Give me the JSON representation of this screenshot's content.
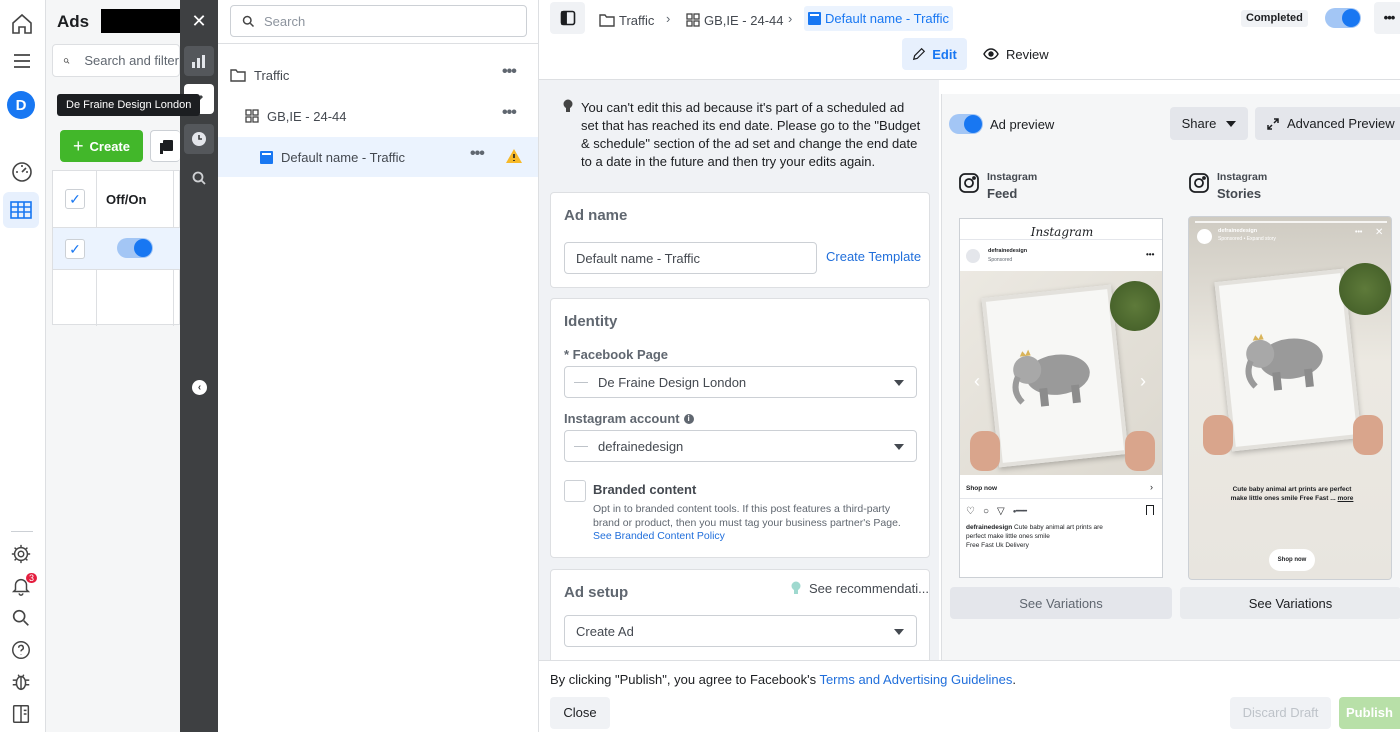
{
  "app": {
    "title": "Ads",
    "avatar_letter": "D",
    "tooltip": "De Fraine Design London",
    "notification_count": "3"
  },
  "ads_manager": {
    "search_placeholder": "Search and filter",
    "create_label": "Create",
    "col_offon": "Off/On"
  },
  "tree": {
    "search_placeholder": "Search",
    "items": [
      {
        "label": "Traffic"
      },
      {
        "label": "GB,IE - 24-44"
      },
      {
        "label": "Default name - Traffic"
      }
    ]
  },
  "breadcrumb": {
    "campaign": "Traffic",
    "adset": "GB,IE - 24-44",
    "ad": "Default name - Traffic"
  },
  "topbar": {
    "status": "Completed",
    "edit_label": "Edit",
    "review_label": "Review"
  },
  "notice": {
    "text": "You can't edit this ad because it's part of a scheduled ad set that has reached its end date. Please go to the \"Budget & schedule\" section of the ad set and change the end date to a date in the future and then try your edits again."
  },
  "ad_name": {
    "heading": "Ad name",
    "value": "Default name - Traffic",
    "create_template": "Create Template"
  },
  "identity": {
    "heading": "Identity",
    "facebook_page_label": "* Facebook Page",
    "facebook_page_value": "De Fraine Design London",
    "instagram_label": "Instagram account",
    "instagram_value": "defrainedesign",
    "branded_title": "Branded content",
    "branded_desc": "Opt in to branded content tools. If this post features a third-party brand or product, then you must tag your business partner's Page.",
    "branded_link": "See Branded Content Policy"
  },
  "ad_setup": {
    "heading": "Ad setup",
    "recommendations": "See recommendati...",
    "value": "Create Ad"
  },
  "preview": {
    "toggle_label": "Ad preview",
    "share_label": "Share",
    "advanced_label": "Advanced Preview",
    "placements": [
      {
        "platform": "Instagram",
        "name": "Feed",
        "variations": "See Variations"
      },
      {
        "platform": "Instagram",
        "name": "Stories",
        "variations": "See Variations"
      }
    ],
    "feed": {
      "header": "Instagram",
      "username": "defrainedesign",
      "sponsored": "Sponsored",
      "cta": "Shop now",
      "caption_user": "defrainedesign",
      "caption": "Cute baby animal art prints are perfect make little ones smile",
      "caption2": "Free Fast Uk Delivery"
    },
    "stories": {
      "username": "defrainedesign",
      "sponsored": "Sponsored • Expand story",
      "caption": "Cute baby animal art prints are perfect make little ones smile Free Fast ...",
      "more": "more",
      "cta": "Shop now"
    }
  },
  "footer": {
    "terms_prefix": "By clicking \"Publish\", you agree to Facebook's ",
    "terms_link": "Terms and Advertising Guidelines",
    "terms_suffix": ".",
    "close": "Close",
    "discard": "Discard Draft",
    "publish": "Publish"
  }
}
